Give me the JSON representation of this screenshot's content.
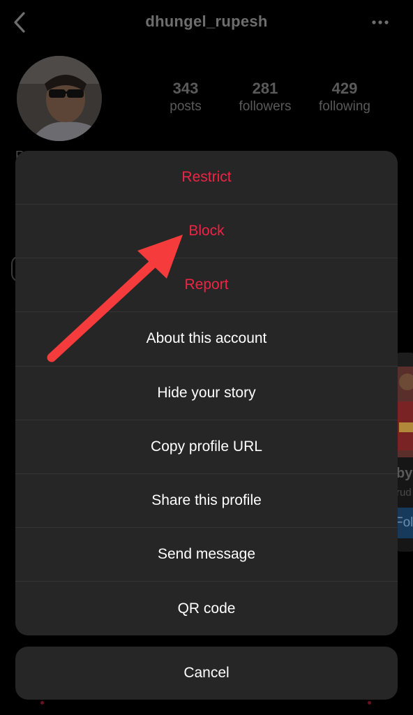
{
  "header": {
    "username": "dhungel_rupesh",
    "back_icon": "chevron-left-icon",
    "more_icon": "more-horizontal-icon"
  },
  "profile": {
    "stats": [
      {
        "value": "343",
        "label": "posts"
      },
      {
        "value": "281",
        "label": "followers"
      },
      {
        "value": "429",
        "label": "following"
      }
    ]
  },
  "background": {
    "bio_fragment": "R",
    "card_title_fragment": "by",
    "card_sub_fragment": "rud",
    "card_button_fragment": "Fol"
  },
  "menu": {
    "items": [
      {
        "label": "Restrict",
        "danger": true
      },
      {
        "label": "Block",
        "danger": true
      },
      {
        "label": "Report",
        "danger": true
      },
      {
        "label": "About this account",
        "danger": false
      },
      {
        "label": "Hide your story",
        "danger": false
      },
      {
        "label": "Copy profile URL",
        "danger": false
      },
      {
        "label": "Share this profile",
        "danger": false
      },
      {
        "label": "Send message",
        "danger": false
      },
      {
        "label": "QR code",
        "danger": false
      }
    ],
    "cancel_label": "Cancel"
  },
  "annotation": {
    "color": "#f53b3b",
    "icon": "red-arrow-annotation"
  },
  "colors": {
    "danger": "#ed2446",
    "sheet": "#262626",
    "background": "#000000"
  }
}
